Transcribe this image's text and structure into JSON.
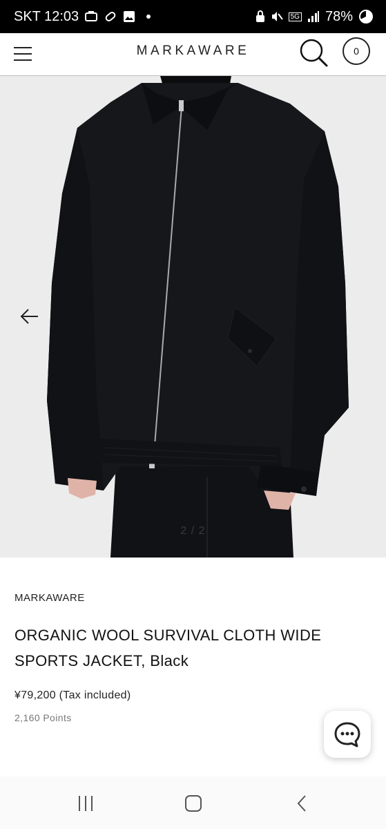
{
  "status_bar": {
    "carrier_time": "SKT 12:03",
    "battery": "78%",
    "network": "5G",
    "icons": [
      "game-icon",
      "link-icon",
      "image-icon",
      "lock-icon",
      "mute-icon",
      "signal-icon",
      "battery-icon"
    ]
  },
  "header": {
    "brand": "MARKAWARE",
    "cart_count": "0",
    "menu_icon": "hamburger-icon",
    "search_icon": "search-icon"
  },
  "gallery": {
    "counter": "2 / 2",
    "background": "#ececec",
    "garment_color": "#15171b"
  },
  "product": {
    "vendor": "MARKAWARE",
    "title": "ORGANIC WOOL SURVIVAL CLOTH WIDE SPORTS JACKET, Black",
    "price": "¥79,200 (Tax included)",
    "points": "2,160 Points"
  },
  "chat": {
    "icon": "chat-icon"
  },
  "nav": {
    "icons": [
      "recent-apps-icon",
      "home-icon",
      "back-icon"
    ]
  }
}
